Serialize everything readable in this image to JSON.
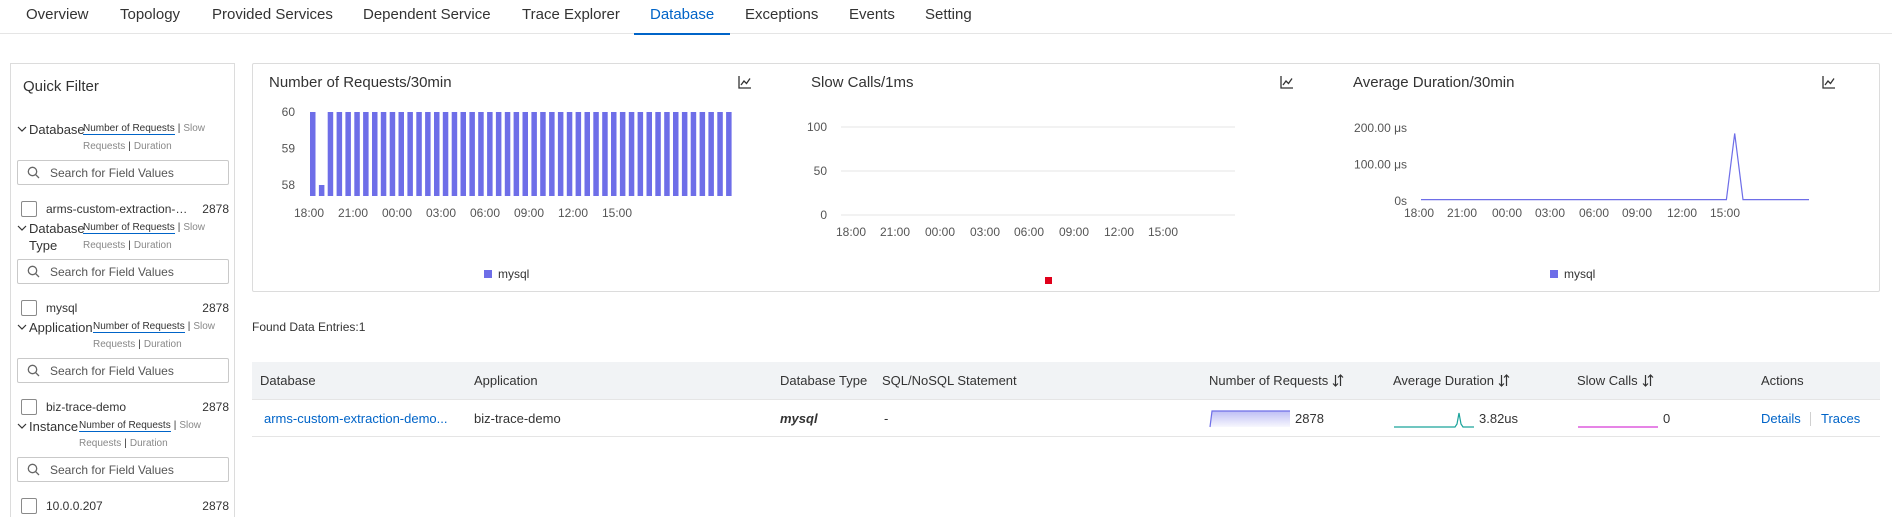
{
  "tabs": [
    "Overview",
    "Topology",
    "Provided Services",
    "Dependent Service",
    "Trace Explorer",
    "Database",
    "Exceptions",
    "Events",
    "Setting"
  ],
  "active_tab": "Database",
  "quick_filter": {
    "title": "Quick Filter",
    "metric_active": "Number of Requests",
    "metric_slow_a": "Slow",
    "metric_slow_b": "Requests",
    "metric_duration": "Duration",
    "search_placeholder": "Search for Field Values",
    "sections": [
      {
        "name": "Database",
        "item_label": "arms-custom-extraction-demo-db",
        "item_count": "2878"
      },
      {
        "name_a": "Database",
        "name_b": "Type",
        "item_label": "mysql",
        "item_count": "2878"
      },
      {
        "name": "Application",
        "item_label": "biz-trace-demo",
        "item_count": "2878"
      },
      {
        "name": "Instance",
        "item_label": "10.0.0.207",
        "item_count": "2878"
      }
    ]
  },
  "chart_data": [
    {
      "type": "bar",
      "title": "Number of Requests/30min",
      "legend": [
        "mysql"
      ],
      "x_tick_labels": [
        "18:00",
        "21:00",
        "00:00",
        "03:00",
        "06:00",
        "09:00",
        "12:00",
        "15:00"
      ],
      "y_tick_labels": [
        "58",
        "59",
        "60"
      ],
      "ylim": [
        57.7,
        60
      ],
      "series": [
        {
          "name": "mysql",
          "color": "#6e6ee8",
          "values": [
            60,
            58,
            60,
            60,
            60,
            60,
            60,
            60,
            60,
            60,
            60,
            60,
            60,
            60,
            60,
            60,
            60,
            60,
            60,
            60,
            60,
            60,
            60,
            60,
            60,
            60,
            60,
            60,
            60,
            60,
            60,
            60,
            60,
            60,
            60,
            60,
            60,
            60,
            60,
            60,
            60,
            60,
            60,
            60,
            60,
            60,
            60,
            60
          ]
        }
      ]
    },
    {
      "type": "bar",
      "title": "Slow Calls/1ms",
      "x_tick_labels": [
        "18:00",
        "21:00",
        "00:00",
        "03:00",
        "06:00",
        "09:00",
        "12:00",
        "15:00"
      ],
      "y_tick_labels": [
        "0",
        "50",
        "100"
      ],
      "ylim": [
        0,
        100
      ],
      "legend_marker_color": "#e0001b",
      "series": []
    },
    {
      "type": "line",
      "title": "Average Duration/30min",
      "legend": [
        "mysql"
      ],
      "x_tick_labels": [
        "18:00",
        "21:00",
        "00:00",
        "03:00",
        "06:00",
        "09:00",
        "12:00",
        "15:00"
      ],
      "y_tick_labels": [
        "0s",
        "100.00 μs",
        "200.00 μs"
      ],
      "ylim": [
        0,
        200
      ],
      "series": [
        {
          "name": "mysql",
          "color": "#6e6ee8",
          "values": [
            3.8,
            3.8,
            3.8,
            3.8,
            3.8,
            3.8,
            3.8,
            3.8,
            3.8,
            3.8,
            3.8,
            3.8,
            3.8,
            3.8,
            3.8,
            3.8,
            3.8,
            3.8,
            3.8,
            3.8,
            3.8,
            3.8,
            3.8,
            3.8,
            3.8,
            3.8,
            3.8,
            3.8,
            3.8,
            3.8,
            3.8,
            3.8,
            3.8,
            3.8,
            3.8,
            3.8,
            3.8,
            3.8,
            185,
            3.8,
            3.8,
            3.8,
            3.8,
            3.8,
            3.8,
            3.8,
            3.8,
            3.8
          ]
        }
      ]
    }
  ],
  "found_entries": "Found Data Entries:1",
  "table": {
    "headers": [
      "Database",
      "Application",
      "Database Type",
      "SQL/NoSQL Statement",
      "Number of Requests",
      "Average Duration",
      "Slow Calls",
      "Actions"
    ],
    "row": {
      "database": "arms-custom-extraction-demo...",
      "application": "biz-trace-demo",
      "database_type": "mysql",
      "statement": "-",
      "requests": "2878",
      "avg_duration": "3.82us",
      "slow_calls": "0",
      "action_details": "Details",
      "action_traces": "Traces"
    }
  },
  "colors": {
    "accent": "#0064c8",
    "series": "#6e6ee8",
    "teal": "#1aa39b",
    "pink": "#d63bd6",
    "red": "#e0001b"
  }
}
